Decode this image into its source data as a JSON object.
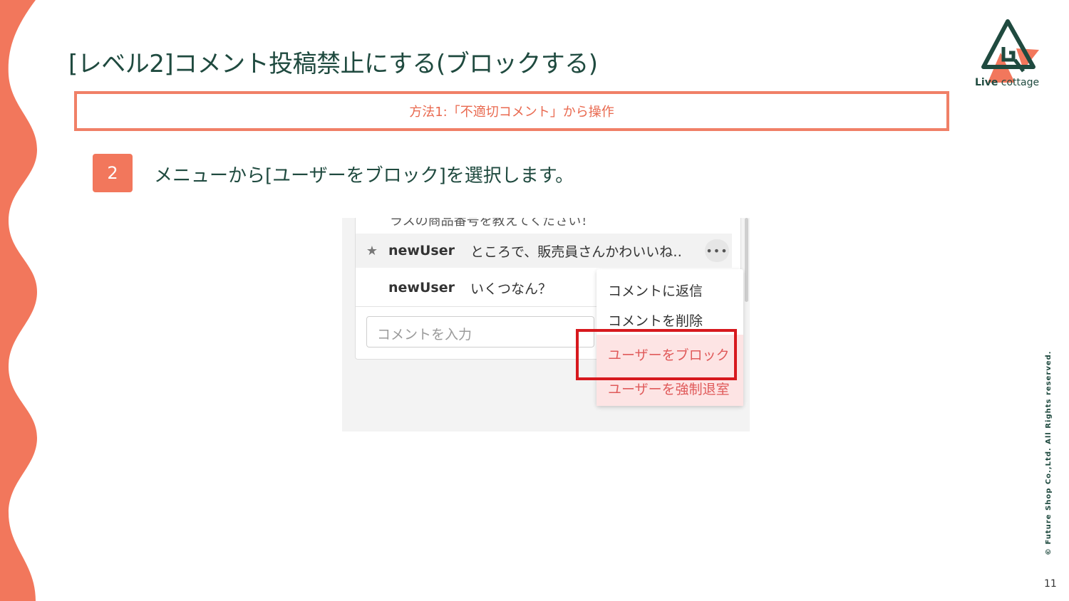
{
  "slide": {
    "title": "[レベル2]コメント投稿禁止にする(ブロックする)",
    "method_box": "方法1:「不適切コメント」から操作",
    "step_number": "2",
    "step_text": "メニューから[ユーザーをブロック]を選択します。",
    "logo_text_bold": "Live",
    "logo_text_rest": " cottage",
    "copyright": "© Future Shop Co.,Ltd. All Rights reserved.",
    "page_number": "11"
  },
  "screenshot": {
    "cut_off_row": "ラスの商品番号を教えてください！",
    "comments": [
      {
        "user": "newUser",
        "message": "ところで、販売員さんかわいいね‥",
        "starred": true
      },
      {
        "user": "newUser",
        "message": "いくつなん？",
        "starred": false
      }
    ],
    "star_glyph": "★",
    "more_glyph": "•••",
    "input_placeholder": "コメントを入力",
    "menu_items": [
      "コメントに返信",
      "コメントを削除",
      "ユーザーをブロック",
      "ユーザーを強制退室"
    ]
  },
  "colors": {
    "accent": "#f2775c",
    "title_green": "#1f4a3f",
    "highlight_red": "#d7191e"
  }
}
